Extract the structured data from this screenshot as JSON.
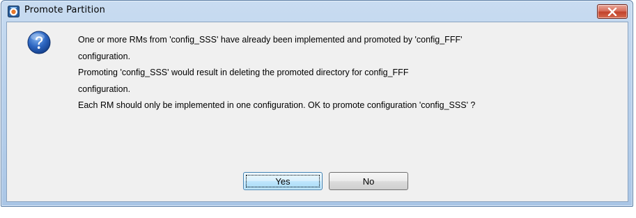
{
  "window": {
    "title": "Promote Partition"
  },
  "icons": {
    "app": "app-icon",
    "close": "close-icon",
    "question": "question-icon"
  },
  "colors": {
    "close_button": "#c94a33",
    "client_background": "#f0f0f0",
    "question_icon": "#1c4f9c"
  },
  "dialog": {
    "message_lines": [
      "One or more RMs from 'config_SSS' have already been implemented and promoted by 'config_FFF'",
      "configuration.",
      "Promoting 'config_SSS' would result in deleting the promoted directory for config_FFF",
      "configuration.",
      "Each RM should only be implemented in one configuration. OK to promote configuration 'config_SSS' ?"
    ],
    "yes_label": "Yes",
    "no_label": "No"
  }
}
